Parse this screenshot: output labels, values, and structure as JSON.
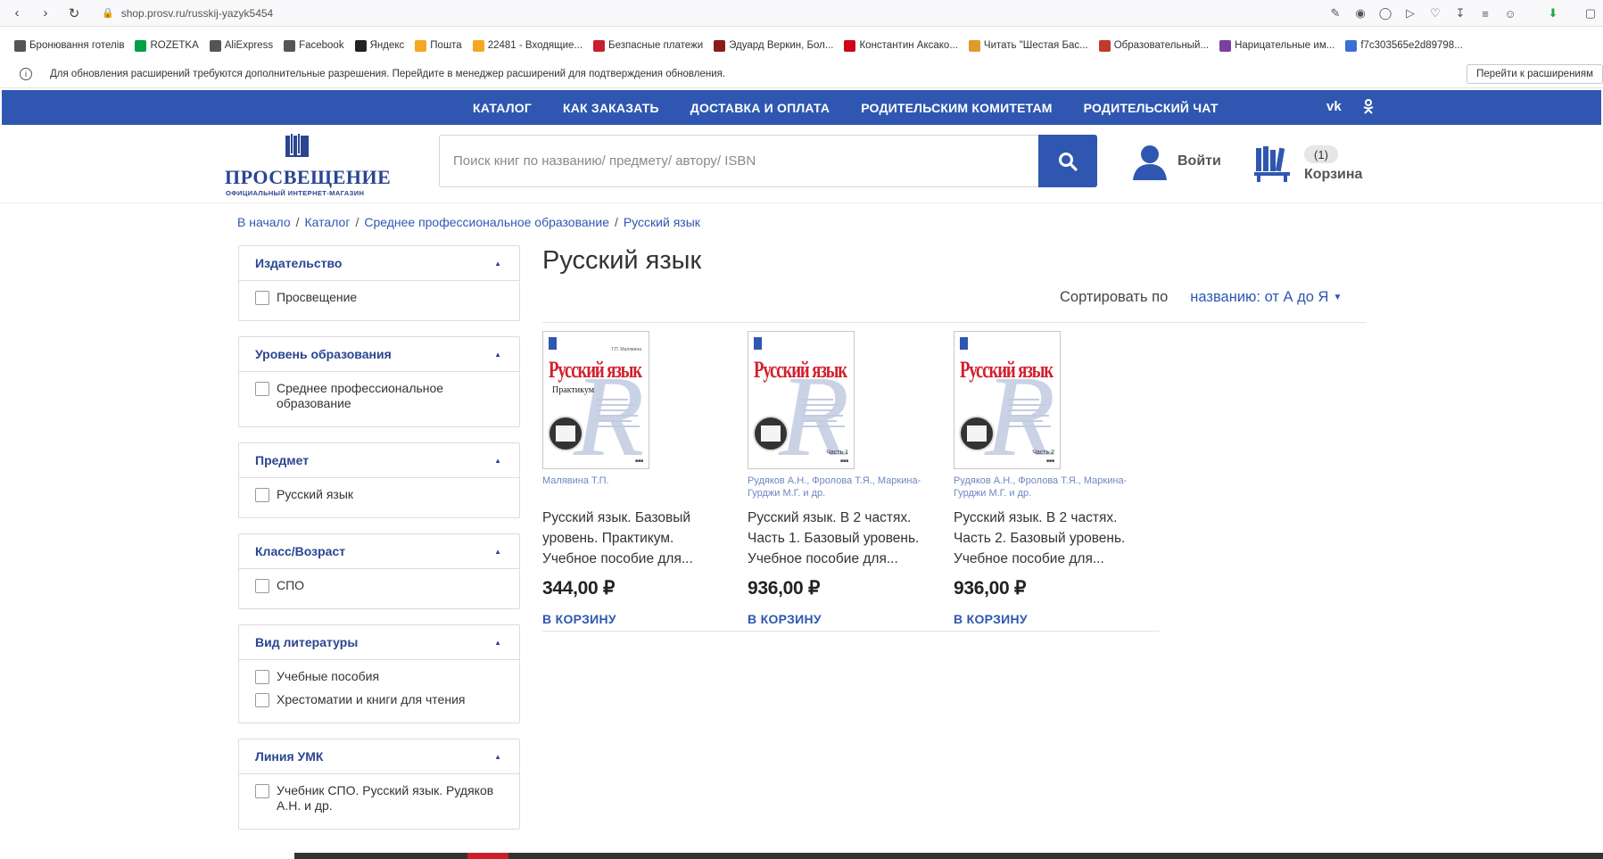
{
  "browser": {
    "url": "shop.prosv.ru/russkij-yazyk5454"
  },
  "bookmarks": [
    {
      "label": "Бронювання готелів",
      "icon": "page-icon",
      "color": "#555555"
    },
    {
      "label": "ROZETKA",
      "icon": "rozetka-icon",
      "color": "#00a046"
    },
    {
      "label": "AliExpress",
      "icon": "page-icon",
      "color": "#555555"
    },
    {
      "label": "Facebook",
      "icon": "page-icon",
      "color": "#555555"
    },
    {
      "label": "Яндекс",
      "icon": "yandex-icon",
      "color": "#222222"
    },
    {
      "label": "Пошта",
      "icon": "mail-icon",
      "color": "#f5a623"
    },
    {
      "label": "22481 - Входящие...",
      "icon": "mail-icon",
      "color": "#f5a623"
    },
    {
      "label": "Безпасные платежи",
      "icon": "rgs-icon",
      "color": "#c7202c"
    },
    {
      "label": "Эдуард Веркин, Бол...",
      "icon": "book-icon",
      "color": "#8b1a1a"
    },
    {
      "label": "Константин Аксако...",
      "icon": "star-icon",
      "color": "#d0021b"
    },
    {
      "label": "Читать \"Шестая Бас...",
      "icon": "reader-icon",
      "color": "#e09a2a"
    },
    {
      "label": "Образовательный...",
      "icon": "edu-icon",
      "color": "#c0392b"
    },
    {
      "label": "Нарицательные им...",
      "icon": "dict-icon",
      "color": "#7b3fa0"
    },
    {
      "label": "f7c303565e2d89798...",
      "icon": "flag-icon",
      "color": "#3a6fd8"
    }
  ],
  "infobar": {
    "message": "Для обновления расширений требуются дополнительные разрешения. Перейдите в менеджер расширений для подтверждения обновления.",
    "button": "Перейти к расширениям"
  },
  "topnav": {
    "links": [
      "КАТАЛОГ",
      "КАК ЗАКАЗАТЬ",
      "ДОСТАВКА И ОПЛАТА",
      "РОДИТЕЛЬСКИМ КОМИТЕТАМ",
      "РОДИТЕЛЬСКИЙ ЧАТ"
    ],
    "vk": "vk",
    "ok": "ok",
    "color": "#2f57b1"
  },
  "header": {
    "logo_name": "ПРОСВЕЩЕНИЕ",
    "logo_tagline": "ОФИЦИАЛЬНЫЙ ИНТЕРНЕТ-МАГАЗИН",
    "search_placeholder": "Поиск книг по названию/ предмету/ автору/ ISBN",
    "login_label": "Войти",
    "cart_count": "(1)",
    "cart_label": "Корзина"
  },
  "breadcrumbs": [
    "В начало",
    "Каталог",
    "Среднее профессиональное образование",
    "Русский язык"
  ],
  "filters": [
    {
      "title": "Издательство",
      "options": [
        "Просвещение"
      ]
    },
    {
      "title": "Уровень образования",
      "options": [
        "Среднее профессиональное образование"
      ]
    },
    {
      "title": "Предмет",
      "options": [
        "Русский язык"
      ]
    },
    {
      "title": "Класс/Возраст",
      "options": [
        "СПО"
      ]
    },
    {
      "title": "Вид литературы",
      "options": [
        "Учебные пособия",
        "Хрестоматии и книги для чтения"
      ]
    },
    {
      "title": "Линия УМК",
      "options": [
        "Учебник СПО. Русский язык. Рудяков А.Н. и др."
      ]
    }
  ],
  "main": {
    "title": "Русский язык",
    "sort_label": "Сортировать по",
    "sort_value": "названию: от А до Я"
  },
  "products": [
    {
      "cover_title": "Русский язык",
      "cover_sub": "Практикум",
      "cover_author": "Т.П. Малявина",
      "cover_part": "",
      "author": "Малявина Т.П.",
      "title": "Русский язык. Базовый уровень. Практикум. Учебное пособие для...",
      "price": "344,00 ₽",
      "buy": "В КОРЗИНУ"
    },
    {
      "cover_title": "Русский язык",
      "cover_sub": "",
      "cover_author": "",
      "cover_part": "Часть 1",
      "author": "Рудяков А.Н., Фролова Т.Я., Маркина-Гурджи М.Г. и др.",
      "title": "Русский язык. В 2 частях. Часть 1. Базовый уровень. Учебное пособие для...",
      "price": "936,00 ₽",
      "buy": "В КОРЗИНУ"
    },
    {
      "cover_title": "Русский язык",
      "cover_sub": "",
      "cover_author": "",
      "cover_part": "Часть 2",
      "author": "Рудяков А.Н., Фролова Т.Я., Маркина-Гурджи М.Г. и др.",
      "title": "Русский язык. В 2 частях. Часть 2. Базовый уровень. Учебное пособие для...",
      "price": "936,00 ₽",
      "buy": "В КОРЗИНУ"
    }
  ]
}
